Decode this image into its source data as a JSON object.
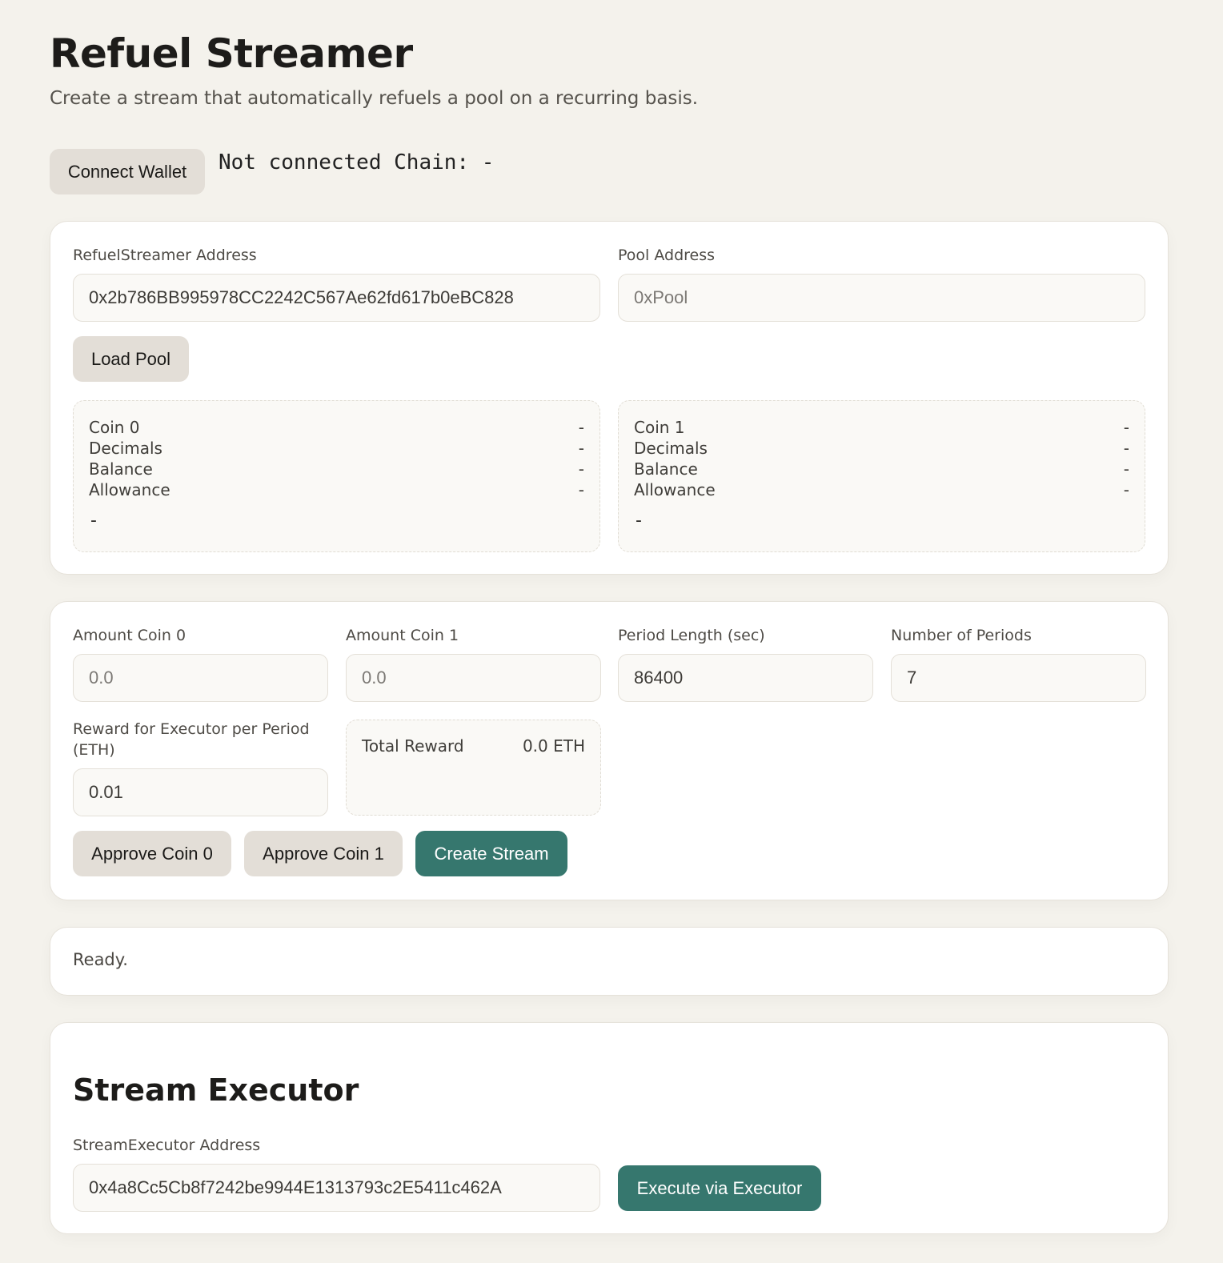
{
  "header": {
    "title": "Refuel Streamer",
    "subtitle": "Create a stream that automatically refuels a pool on a recurring basis."
  },
  "wallet": {
    "connect_label": "Connect Wallet",
    "status": "Not connected Chain: -"
  },
  "pool_card": {
    "streamer_label": "RefuelStreamer Address",
    "streamer_value": "0x2b786BB995978CC2242C567Ae62fd617b0eBC828",
    "pool_label": "Pool Address",
    "pool_placeholder": "0xPool",
    "load_label": "Load Pool",
    "coin0": {
      "rows": [
        {
          "key": "Coin 0",
          "value": "-"
        },
        {
          "key": "Decimals",
          "value": "-"
        },
        {
          "key": "Balance",
          "value": "-"
        },
        {
          "key": "Allowance",
          "value": "-"
        }
      ],
      "footer": "-"
    },
    "coin1": {
      "rows": [
        {
          "key": "Coin 1",
          "value": "-"
        },
        {
          "key": "Decimals",
          "value": "-"
        },
        {
          "key": "Balance",
          "value": "-"
        },
        {
          "key": "Allowance",
          "value": "-"
        }
      ],
      "footer": "-"
    }
  },
  "stream_card": {
    "amount0_label": "Amount Coin 0",
    "amount0_placeholder": "0.0",
    "amount1_label": "Amount Coin 1",
    "amount1_placeholder": "0.0",
    "period_label": "Period Length (sec)",
    "period_value": "86400",
    "num_periods_label": "Number of Periods",
    "num_periods_value": "7",
    "reward_label": "Reward for Executor per Period (ETH)",
    "reward_value": "0.01",
    "total_reward_label": "Total Reward",
    "total_reward_value": "0.0 ETH",
    "approve0_label": "Approve Coin 0",
    "approve1_label": "Approve Coin 1",
    "create_label": "Create Stream"
  },
  "status": {
    "text": "Ready."
  },
  "executor": {
    "title": "Stream Executor",
    "address_label": "StreamExecutor Address",
    "address_value": "0x4a8Cc5Cb8f7242be9944E1313793c2E5411c462A",
    "execute_label": "Execute via Executor"
  },
  "colors": {
    "background": "#f4f2ec",
    "primary": "#36776e",
    "secondary_button": "#e3ded7"
  }
}
